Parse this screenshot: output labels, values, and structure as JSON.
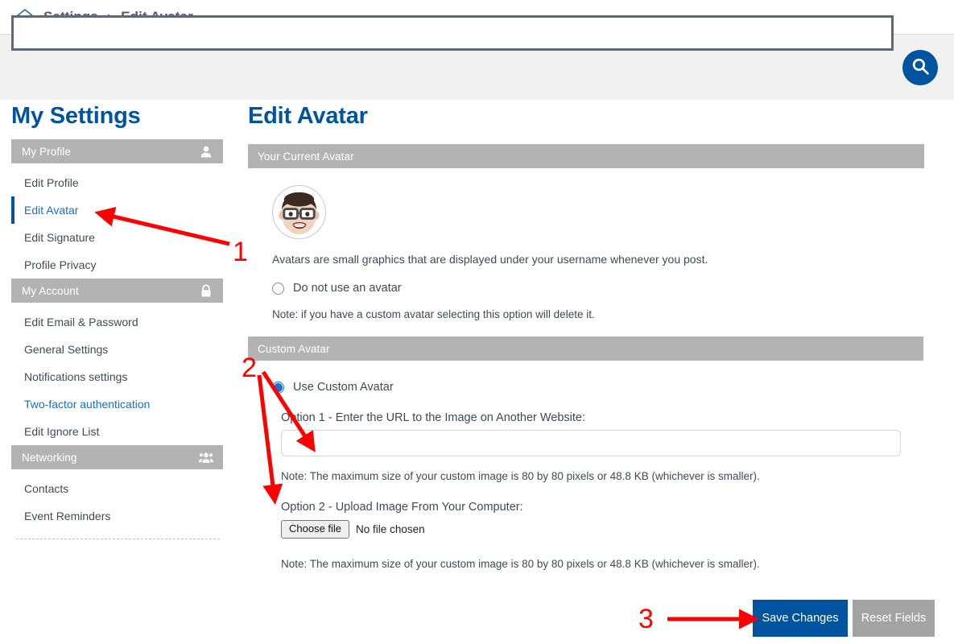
{
  "breadcrumb": {
    "home_icon": "home-icon",
    "items": [
      "Settings",
      "Edit Avatar"
    ],
    "separator": "›"
  },
  "search": {
    "value": "",
    "placeholder": "",
    "button_icon": "search-icon"
  },
  "sidebar": {
    "title": "My Settings",
    "groups": [
      {
        "label": "My Profile",
        "icon": "user-icon",
        "items": [
          {
            "label": "Edit Profile",
            "active": false,
            "link": false
          },
          {
            "label": "Edit Avatar",
            "active": true,
            "link": false
          },
          {
            "label": "Edit Signature",
            "active": false,
            "link": false
          },
          {
            "label": "Profile Privacy",
            "active": false,
            "link": false
          }
        ]
      },
      {
        "label": "My Account",
        "icon": "lock-icon",
        "items": [
          {
            "label": "Edit Email & Password",
            "active": false,
            "link": false
          },
          {
            "label": "General Settings",
            "active": false,
            "link": false
          },
          {
            "label": "Notifications settings",
            "active": false,
            "link": false
          },
          {
            "label": "Two-factor authentication",
            "active": false,
            "link": true
          },
          {
            "label": "Edit Ignore List",
            "active": false,
            "link": false
          }
        ]
      },
      {
        "label": "Networking",
        "icon": "people-icon",
        "items": [
          {
            "label": "Contacts",
            "active": false,
            "link": false
          },
          {
            "label": "Event Reminders",
            "active": false,
            "link": false
          }
        ]
      }
    ]
  },
  "main": {
    "title": "Edit Avatar",
    "current_section": {
      "header": "Your Current Avatar",
      "avatar_icon": "memoji-avatar",
      "description": "Avatars are small graphics that are displayed under your username whenever you post.",
      "no_avatar_radio": {
        "label": "Do not use an avatar",
        "checked": false
      },
      "no_avatar_note": "Note: if you have a custom avatar selecting this option will delete it."
    },
    "custom_section": {
      "header": "Custom Avatar",
      "use_custom_radio": {
        "label": "Use Custom Avatar",
        "checked": true
      },
      "option1_label": "Option 1 - Enter the URL to the Image on Another Website:",
      "url_value": "",
      "url_placeholder": "",
      "note1": "Note: The maximum size of your custom image is 80 by 80 pixels or 48.8 KB (whichever is smaller).",
      "option2_label": "Option 2 - Upload Image From Your Computer:",
      "choose_file_label": "Choose file",
      "file_status": "No file chosen",
      "note2": "Note: The maximum size of your custom image is 80 by 80 pixels or 48.8 KB (whichever is smaller)."
    }
  },
  "footer": {
    "save_label": "Save Changes",
    "reset_label": "Reset Fields"
  },
  "annotations": {
    "color": "#ff0000",
    "markers": [
      {
        "number": "1",
        "target": "sidebar-item-edit-avatar"
      },
      {
        "number": "2",
        "target": "custom-avatar-inputs"
      },
      {
        "number": "3",
        "target": "save-changes-button"
      }
    ]
  },
  "colors": {
    "brand_blue": "#00539f",
    "link_blue": "#1d6fb8",
    "section_gray": "#b3b3b3",
    "strip_gray": "#f1f1f1",
    "annotation_red": "#ff0000"
  }
}
